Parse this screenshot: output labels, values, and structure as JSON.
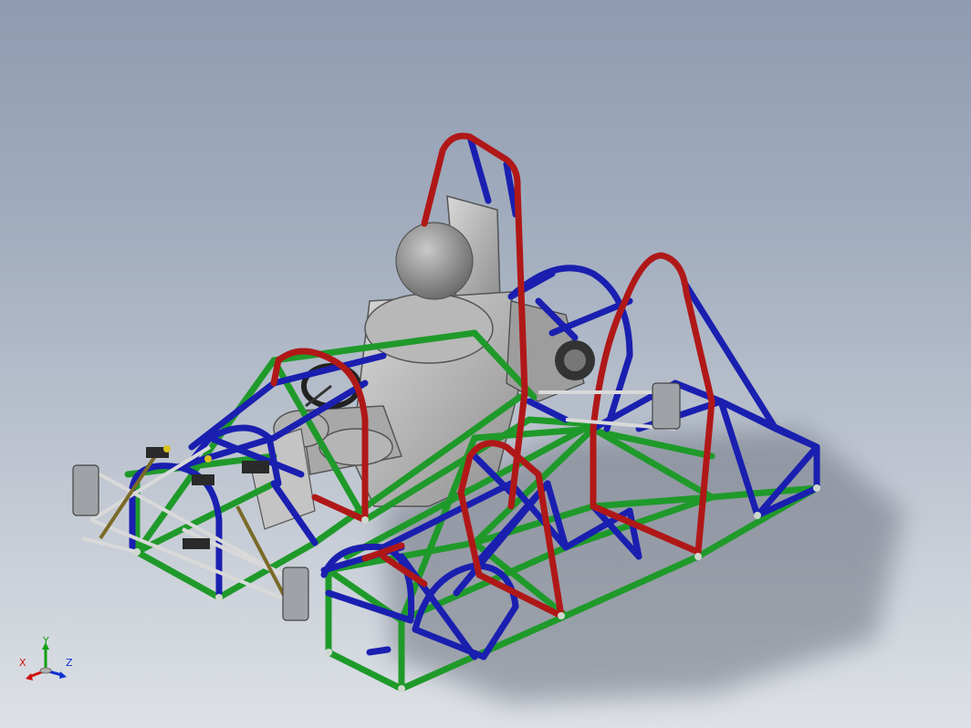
{
  "viewport": {
    "background_top": "#8e9bb0",
    "background_bottom": "#dde1e6"
  },
  "colors": {
    "main_hoop": "#b01818",
    "primary_structure": "#1a1fb0",
    "secondary_structure": "#1f9a2a",
    "seat": "#bfbfbf",
    "driver_head": "#9a9a9a",
    "shadow": "#6d7380"
  },
  "model": {
    "parts": [
      "tubular-frame",
      "roll-hoops",
      "seat",
      "driver-head",
      "steering-wheel",
      "front-suspension",
      "rear-suspension",
      "uprights"
    ]
  },
  "triad": {
    "x_label": "X",
    "y_label": "Y",
    "z_label": "Z",
    "x_color": "#d01010",
    "y_color": "#10a010",
    "z_color": "#1030d0"
  }
}
